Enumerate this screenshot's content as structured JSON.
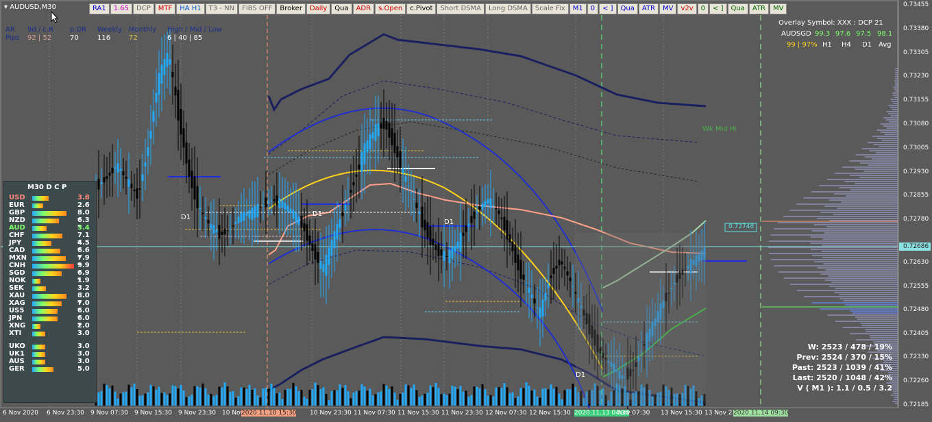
{
  "window": {
    "symbol": "AUDUSD,M30"
  },
  "toolbar": [
    {
      "label": "RA1",
      "color": "#0000cc"
    },
    {
      "label": "1.65",
      "color": "#cc00cc"
    },
    {
      "label": "DCP",
      "color": "#666666"
    },
    {
      "label": "MTF",
      "color": "#cc0000"
    },
    {
      "label": "HA H1",
      "color": "#0055cc"
    },
    {
      "label": "T3 - NN",
      "color": "#666666"
    },
    {
      "label": "FIBS OFF",
      "color": "#666666"
    },
    {
      "label": "Broker",
      "color": "#000000"
    },
    {
      "label": "Daily",
      "color": "#cc0000"
    },
    {
      "label": "Qua",
      "color": "#000000"
    },
    {
      "label": "ADR",
      "color": "#cc0000"
    },
    {
      "label": "s.Open",
      "color": "#cc0000"
    },
    {
      "label": "c.Pivot",
      "color": "#000000"
    },
    {
      "label": "Short DSMA",
      "color": "#666666"
    },
    {
      "label": "Long DSMA",
      "color": "#666666"
    },
    {
      "label": "Scale Fix",
      "color": "#666666"
    },
    {
      "label": "M1",
      "color": "#0000cc"
    },
    {
      "label": "0",
      "color": "#0000cc"
    },
    {
      "label": "< ]",
      "color": "#0000cc"
    },
    {
      "label": "Qua",
      "color": "#0000cc"
    },
    {
      "label": "ATR",
      "color": "#0000cc"
    },
    {
      "label": "MV",
      "color": "#0000cc"
    },
    {
      "label": "v2v",
      "color": "#cc0000"
    },
    {
      "label": "0",
      "color": "#006600"
    },
    {
      "label": "< ]",
      "color": "#006600"
    },
    {
      "label": "Qua",
      "color": "#006600"
    },
    {
      "label": "ATR",
      "color": "#006600"
    },
    {
      "label": "MV",
      "color": "#006600"
    }
  ],
  "adr_header": {
    "ar": "AR",
    "pips": "Pips",
    "d9": "9d / c.R",
    "d9v": "92 | 52",
    "pdr": "p.DR",
    "pdrv": "70",
    "weekly": "Weekly",
    "weeklyv": "116",
    "monthly": "Monthly",
    "monthlyv": "72",
    "hml": "High / Mid / Low",
    "hmlv": "6  |  40  |  85"
  },
  "overlay": {
    "line1": "Overlay Symbol: XXX : DCP 21",
    "sym": "AUDSGD",
    "v1": "99.3",
    "v2": "97.6",
    "v3": "97.5",
    "v4": "98.1",
    "pct": "99 | 97%",
    "h1": "H1",
    "h4": "H4",
    "d1": "D1",
    "avg": "Avg"
  },
  "currency_panel": {
    "title": "M30   D C P",
    "rows": [
      {
        "name": "USD",
        "value": "3.8",
        "strength": 0.38,
        "color": "#ff8a80"
      },
      {
        "name": "EUR",
        "value": "2.6",
        "strength": 0.26,
        "color": "#ffffff"
      },
      {
        "name": "GBP",
        "value": "8.0 *",
        "strength": 0.8,
        "color": "#ffffff"
      },
      {
        "name": "NZD",
        "value": "6.3 *",
        "strength": 0.63,
        "color": "#ffffff"
      },
      {
        "name": "AUD",
        "value": "3.4",
        "strength": 0.34,
        "color": "#7cff6a"
      },
      {
        "name": "CHF",
        "value": "7.1 *",
        "strength": 0.71,
        "color": "#ffffff"
      },
      {
        "name": "JPY",
        "value": "4.5 *",
        "strength": 0.45,
        "color": "#ffffff"
      },
      {
        "name": "CAD",
        "value": "6.6 *",
        "strength": 0.66,
        "color": "#ffffff"
      },
      {
        "name": "MXN",
        "value": "7.9 *",
        "strength": 0.79,
        "color": "#ffffff"
      },
      {
        "name": "CNH",
        "value": "9.9 *",
        "strength": 0.99,
        "color": "#ffffff"
      },
      {
        "name": "SGD",
        "value": "6.9 *",
        "strength": 0.69,
        "color": "#ffffff"
      },
      {
        "name": "NOK",
        "value": "1.9",
        "strength": 0.19,
        "color": "#ffffff"
      },
      {
        "name": "SEK",
        "value": "3.2",
        "strength": 0.32,
        "color": "#ffffff"
      },
      {
        "name": "XAU",
        "value": "8.0 *",
        "strength": 0.8,
        "color": "#ffffff"
      },
      {
        "name": "XAG",
        "value": "7.0 *",
        "strength": 0.7,
        "color": "#ffffff"
      },
      {
        "name": "US5",
        "value": "6.0 *",
        "strength": 0.6,
        "color": "#ffffff"
      },
      {
        "name": "JPN",
        "value": "6.0 *",
        "strength": 0.6,
        "color": "#ffffff"
      },
      {
        "name": "XNG",
        "value": "2.0",
        "strength": 0.2,
        "color": "#ffffff"
      },
      {
        "name": "XTI",
        "value": "3.0",
        "strength": 0.3,
        "color": "#ffffff"
      },
      {
        "name": "UKO",
        "value": "3.0",
        "strength": 0.3,
        "color": "#ffffff"
      },
      {
        "name": "UK1",
        "value": "3.0",
        "strength": 0.3,
        "color": "#ffffff"
      },
      {
        "name": "AUS",
        "value": "3.0",
        "strength": 0.3,
        "color": "#ffffff"
      },
      {
        "name": "GER",
        "value": "5.0",
        "strength": 0.5,
        "color": "#ffffff"
      }
    ]
  },
  "stats": {
    "w": "W: 2523 / 478 / 19%",
    "prev": "Prev: 2524 / 370 / 15%",
    "past": "Past: 2523 / 1039 / 41%",
    "last": "Last: 2520 / 1048 / 42%",
    "v": "V ( M1 ): 1.1 / 0.5 / 3.2"
  },
  "labels": {
    "wk_mid_hi": "Wk Mid Hi",
    "d1": "D1",
    "price_marker": "0.72748",
    "current_price": "0.72686"
  },
  "x_axis": [
    "6 Nov 2020",
    "6 Nov 23:30",
    "9 Nov 07:30",
    "9 Nov 15:30",
    "9 Nov 23:30",
    "10 Nov",
    "2020.11.10 15:30",
    "10 Nov 23:30",
    "11 Nov 07:30",
    "11 Nov 15:30",
    "11 Nov 23:30",
    "12 Nov 07:30",
    "12 Nov 15:30",
    "2020.11.13 04:30",
    "Nov 07:30",
    "13 Nov 15:30",
    "13 Nov 23",
    "2020.11.14 09:30"
  ],
  "y_axis": [
    "0.73455",
    "0.73380",
    "0.73305",
    "0.73230",
    "0.73155",
    "0.73080",
    "0.73005",
    "0.72930",
    "0.72855",
    "0.72780",
    "0.72686",
    "0.72630",
    "0.72555",
    "0.72480",
    "0.72405",
    "0.72330",
    "0.72260",
    "0.72185"
  ],
  "chart_data": {
    "type": "candlestick",
    "ylim": [
      0.72185,
      0.73455
    ],
    "current_price": 0.72686,
    "candles_mid": [
      0.7288,
      0.7291,
      0.7295,
      0.729,
      0.7285,
      0.73,
      0.7322,
      0.733,
      0.731,
      0.7292,
      0.7281,
      0.7276,
      0.7273,
      0.7275,
      0.7279,
      0.728,
      0.7282,
      0.7284,
      0.7283,
      0.728,
      0.7276,
      0.7268,
      0.7262,
      0.7272,
      0.7281,
      0.729,
      0.73,
      0.7306,
      0.7308,
      0.73,
      0.729,
      0.7282,
      0.7274,
      0.7268,
      0.7266,
      0.727,
      0.7276,
      0.7281,
      0.7284,
      0.728,
      0.7272,
      0.7262,
      0.7255,
      0.7248,
      0.726,
      0.7265,
      0.7258,
      0.725,
      0.7242,
      0.7235,
      0.7232,
      0.7228,
      0.723,
      0.7238,
      0.7245,
      0.7252,
      0.7258,
      0.7262,
      0.7265,
      0.7268
    ]
  }
}
